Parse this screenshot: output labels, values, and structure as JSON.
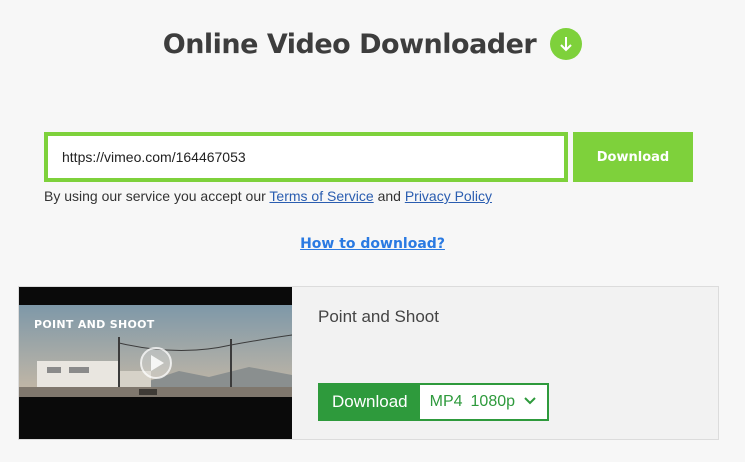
{
  "header": {
    "title": "Online Video Downloader",
    "icon": "download-circle-icon"
  },
  "form": {
    "url_value": "https://vimeo.com/164467053",
    "download_label": "Download"
  },
  "terms": {
    "prefix": "By using our service you accept our",
    "tos_label": "Terms of Service",
    "and": "and",
    "privacy_label": "Privacy Policy"
  },
  "howto": {
    "label": "How to download?"
  },
  "result": {
    "video_title": "Point and Shoot",
    "thumbnail_caption": "POINT AND SHOOT",
    "download_label": "Download",
    "format": "MP4",
    "quality": "1080p"
  },
  "colors": {
    "accent": "#7ed13b",
    "download_green": "#2e9a3c",
    "link": "#2a5db0"
  }
}
